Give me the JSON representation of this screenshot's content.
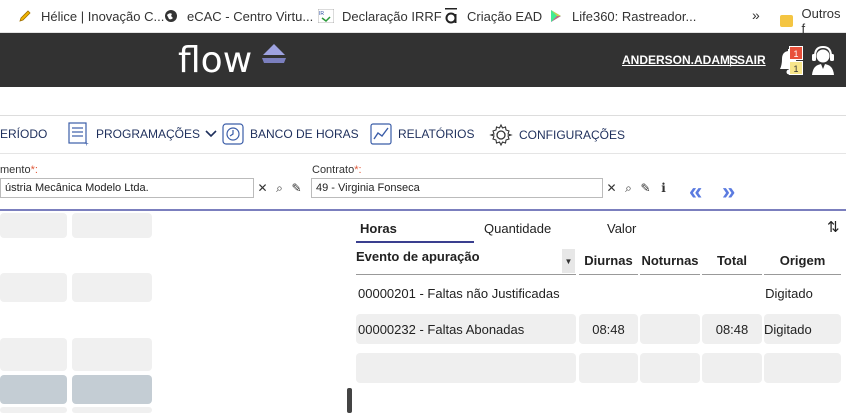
{
  "bookmarks": {
    "items": [
      {
        "label": "Hélice | Inovação C...",
        "icon": "pencil-icon"
      },
      {
        "label": "eCAC - Centro Virtu...",
        "icon": "globe-icon"
      },
      {
        "label": "Declaração IRRF",
        "icon": "irrf-icon"
      },
      {
        "label": "Criação EAD",
        "icon": "a-logo-icon"
      },
      {
        "label": "Life360: Rastreador...",
        "icon": "play-store-icon"
      }
    ],
    "more": "»",
    "other_folder": "Outros f"
  },
  "header": {
    "logo": "flow",
    "user": "ANDERSON.ADAMS",
    "separator": "|",
    "logout": "SAIR",
    "badge_red": "1",
    "badge_yellow": "1"
  },
  "menu": {
    "periodo": "ERÍODO",
    "programacoes": "PROGRAMAÇÕES",
    "banco_horas": "BANCO DE HORAS",
    "relatorios": "RELATÓRIOS",
    "configuracoes": "CONFIGURAÇÕES"
  },
  "filters": {
    "estab_label": "mento",
    "estab_req": "*:",
    "estab_value": "ústria Mecânica Modelo Ltda.",
    "contrato_label": "Contrato",
    "contrato_req": "*:",
    "contrato_value": "49 - Virginia Fonseca",
    "clear": "✕",
    "search": "⌕",
    "edit": "✎",
    "info": "i",
    "prev": "«",
    "next": "»"
  },
  "tabs": {
    "horas": "Horas",
    "quantidade": "Quantidade",
    "valor": "Valor",
    "sort": "⇅"
  },
  "table": {
    "headers": {
      "evento": "Evento de apuração",
      "diurnas": "Diurnas",
      "noturnas": "Noturnas",
      "total": "Total",
      "origem": "Origem"
    },
    "rows": [
      {
        "evento": "00000201 - Faltas não Justificadas",
        "diurnas": "",
        "noturnas": "",
        "total": "",
        "origem": "Digitado"
      },
      {
        "evento": "00000232 - Faltas Abonadas",
        "diurnas": "08:48",
        "noturnas": "",
        "total": "08:48",
        "origem": "Digitado"
      },
      {
        "evento": "",
        "diurnas": "",
        "noturnas": "",
        "total": "",
        "origem": ""
      }
    ]
  },
  "colors": {
    "header_bg": "#323232",
    "accent": "#7b7fbe",
    "menu_text": "#1e2f5c",
    "arrows": "#5b7be0",
    "badge_red": "#e8503a",
    "badge_yellow": "#f7e58a"
  }
}
